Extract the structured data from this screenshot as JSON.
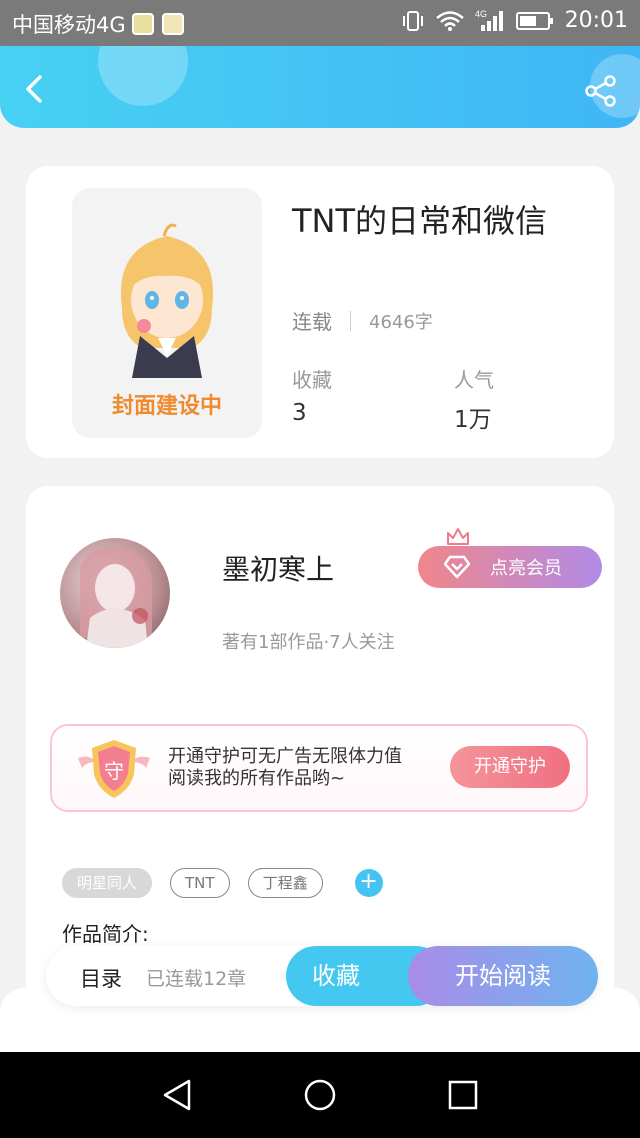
{
  "status_bar": {
    "carrier": "中国移动4G",
    "network": "4G",
    "time": "20:01"
  },
  "header": {
    "back_icon": "chevron-left-icon",
    "share_icon": "share-icon",
    "gradient": [
      "#47d1f3",
      "#3fb6f5"
    ]
  },
  "book": {
    "title": "TNT的日常和微信",
    "cover_label": "封面建设中",
    "status": "连载",
    "word_count": "4646字",
    "stats": [
      {
        "label": "收藏",
        "value": "3"
      },
      {
        "label": "人气",
        "value": "1万"
      }
    ]
  },
  "author": {
    "name": "墨初寒上",
    "meta": "著有1部作品·7人关注",
    "vip_button": "点亮会员"
  },
  "guard": {
    "badge_char": "守",
    "text": "开通守护可无广告无限体力值阅读我的所有作品哟~",
    "button": "开通守护"
  },
  "tags": [
    "明星同人",
    "TNT",
    "丁程鑫"
  ],
  "intro_label": "作品简介:",
  "action_bar": {
    "toc": "目录",
    "chapter_count": "已连载12章",
    "favorite": "收藏",
    "start_reading": "开始阅读"
  },
  "colors": {
    "accent": "#45c3f2",
    "vip_start": "#f0868b",
    "vip_end": "#b18be6",
    "cover_label": "#ef8a2e"
  }
}
